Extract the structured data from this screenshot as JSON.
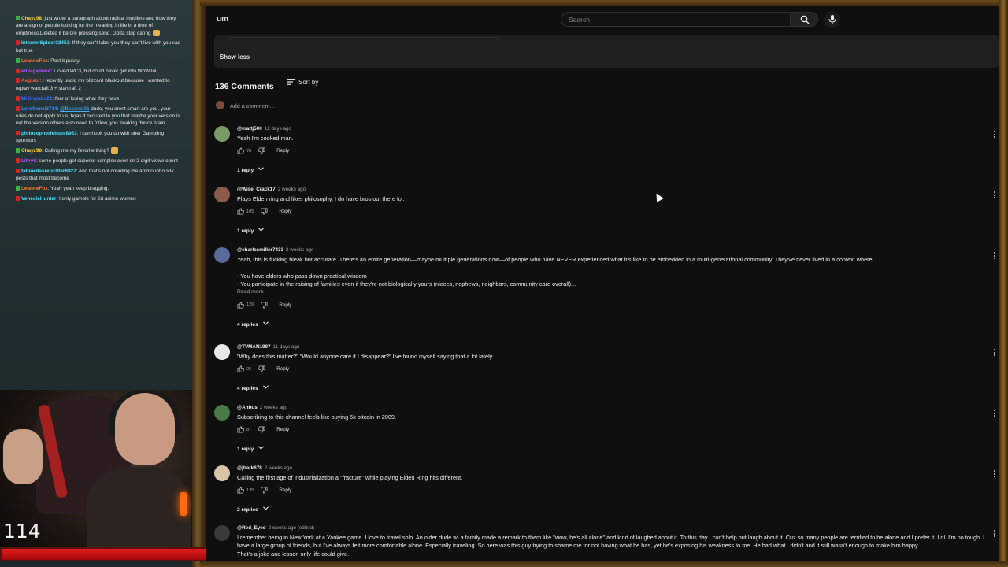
{
  "chat": {
    "messages": [
      {
        "user": "Chayz98",
        "user_color": "#ffd42a",
        "badge": "green",
        "text": ": just wrote a paragraph about radical muslims and how they are a sign of people looking for the meaning in life in a time of emptiness.Deleted it before pressing send. Gotta stop caring",
        "emote": true
      },
      {
        "user": "InternetSpider33453",
        "user_color": "#4fe3ff",
        "badge": "red",
        "text": ": If they can't label you they can't live with you sad but true"
      },
      {
        "user": "LeanneFox",
        "user_color": "#ff7a2a",
        "badge": "green",
        "text": ": Post it pussy."
      },
      {
        "user": "edvagabond",
        "user_color": "#b64fff",
        "badge": "red",
        "text": ": I loved WC3, but could never get into WoW lol"
      },
      {
        "user": "Aegisto",
        "user_color": "#ff5a3c",
        "badge": "red",
        "text": ": I recently undid my blizzard blackout because i wanted to replay warcraft 3 + starcraft 2"
      },
      {
        "user": "MrGrambo21",
        "user_color": "#3b6bff",
        "badge": "red",
        "text": ": fear of losing what they have"
      },
      {
        "user": "LordRenzi2714",
        "user_color": "#3a8bff",
        "badge": "red",
        "mention": "@Bacardo96",
        "text": " dude, you arent smart are you. your rules do not apply to us, hqas it occured to you that maybe your version is not the version others also need to follow, you freaking dunce brain"
      },
      {
        "user": "philosopherfeltoor8963",
        "user_color": "#4fe3ff",
        "badge": "red",
        "text": ": i can hook you up with uber Gambling sponsors"
      },
      {
        "user": "Chayz98",
        "user_color": "#ffd42a",
        "badge": "green",
        "text": ": Calling me my favorite thing?",
        "emote": true
      },
      {
        "user": "Lithy6",
        "user_color": "#b64fff",
        "badge": "red",
        "text": ": some people get superior complex even on 2 digit viewe count"
      },
      {
        "user": "fabioellasreisritter8827",
        "user_color": "#4fe3ff",
        "badge": "red",
        "text": ": And that's not counting the ammount o s3x pests that most become"
      },
      {
        "user": "LeanneFox",
        "user_color": "#ff7a2a",
        "badge": "green",
        "text": ": Yeah yeah keep bragging."
      },
      {
        "user": "VenecieHunter",
        "user_color": "#4fe3ff",
        "badge": "red",
        "text": ": I only gamble for 2d anime women"
      }
    ]
  },
  "overlay": {
    "counter": "114",
    "bar_fill_fraction": 0.97,
    "bar_color": "#e11d1d"
  },
  "youtube": {
    "logo_fragment": "um",
    "search": {
      "placeholder": "Search"
    },
    "description": {
      "show_less": "Show less"
    },
    "comments": {
      "count_label": "136 Comments",
      "sort_label": "Sort by",
      "add_placeholder": "Add a comment...",
      "reply_label": "Reply",
      "read_more": "Read more",
      "items": [
        {
          "author": "@mattj500",
          "time": "12 days ago",
          "avatar_color": "#7b9a6a",
          "lines": [
            "Yeah I'm cooked man."
          ],
          "likes": "78",
          "replies": "1 reply"
        },
        {
          "author": "@Wise_Crack17",
          "time": "2 weeks ago",
          "avatar_color": "#8a5a4a",
          "lines": [
            "Plays Elden ring and likes philosophy, I do have bros out there lol."
          ],
          "likes": "105",
          "replies": "1 reply"
        },
        {
          "author": "@charlesmiller7433",
          "time": "2 weeks ago",
          "avatar_color": "#5a6a9a",
          "lines": [
            "Yeah, this is fucking bleak but accurate. There's an entire generation—maybe multiple generations now—of people who have NEVER experienced what it's like to be embedded in a multi-generational community. They've never lived in a context where:",
            "",
            "- You have elders who pass down practical wisdom",
            "- You participate in the raising of families even if they're not biologically yours (nieces, nephews, neighbors, community care overall)..."
          ],
          "read_more": true,
          "likes": "126",
          "replies": "4 replies"
        },
        {
          "author": "@TVMAN1997",
          "time": "11 days ago",
          "avatar_color": "#e8e8e8",
          "lines": [
            "\"Why does this matter?\" \"Would anyone care if I disappear?\" I've found myself saying that a lot lately."
          ],
          "likes": "26",
          "replies": "4 replies"
        },
        {
          "author": "@Anbus",
          "time": "2 weeks ago",
          "avatar_color": "#4a7a4a",
          "lines": [
            "Subscribing to this channel feels like buying 5k bitcoin in 2009."
          ],
          "likes": "87",
          "replies": "1 reply"
        },
        {
          "author": "@jbark678",
          "time": "2 weeks ago",
          "avatar_color": "#d8c4a8",
          "lines": [
            "Calling the first age of industrialization a \"fracture\" while playing Elden Ring hits different."
          ],
          "likes": "135",
          "replies": "2 replies"
        },
        {
          "author": "@Red_Eyed",
          "time": "2 weeks ago (edited)",
          "avatar_color": "#3a3a3a",
          "lines": [
            "I remember being in New York at a Yankee game. I love to travel solo. An older dude w\\ a family made a remark to them like \"wow, he's all alone\" and kind of laughed about it. To this day I can't help but laugh about it. Cuz so many people are terrified to be alone and I prefer it. Lol. I'm no tough. I have a large group of friends, but I've always felt more comfortable alone. Especially traveling. So here was this guy trying to shame me for not having what he has, yet he's exposing his weakness to me. He had what I didn't and it still wasn't enough to make him happy.",
            "That's a joke and lesson only life could give."
          ]
        }
      ]
    }
  }
}
